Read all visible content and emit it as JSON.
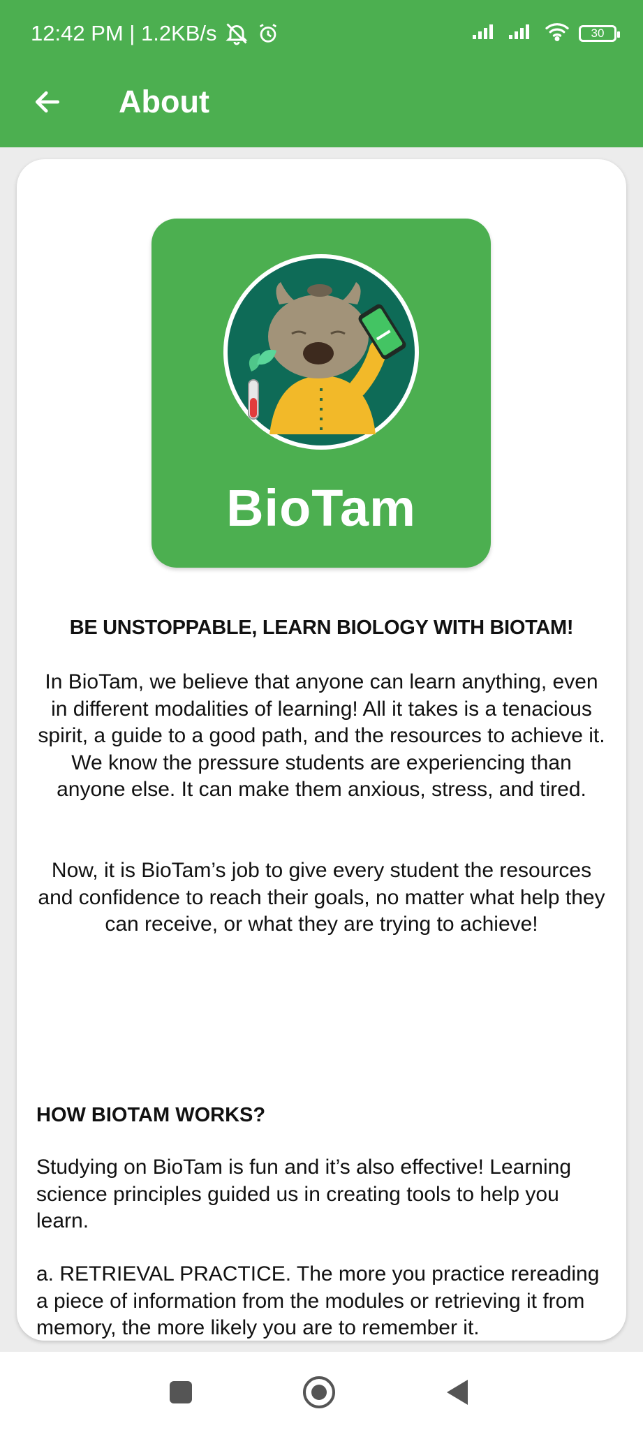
{
  "status_bar": {
    "time_speed": "12:42 PM | 1.2KB/s",
    "icons": [
      "silent-bell-icon",
      "alarm-icon",
      "signal-icon",
      "signal-icon",
      "wifi-icon",
      "battery-icon"
    ],
    "battery_level": "30"
  },
  "toolbar": {
    "back_icon": "arrow-left-icon",
    "title": "About",
    "color": "#4CAF50"
  },
  "logo": {
    "name": "BioTam",
    "tile_color": "#4CAF50"
  },
  "about": {
    "slogan": "BE UNSTOPPABLE, LEARN BIOLOGY WITH BIOTAM!",
    "paragraph1": "In BioTam, we believe that anyone can learn anything, even in different modalities of learning! All it takes is a tenacious spirit, a guide to a good path, and the resources to achieve it. We know the pressure students are experiencing than anyone else. It can make them anxious, stress, and tired.",
    "paragraph2": "Now, it is BioTam’s job to give every student the resources and confidence to reach their goals, no matter what help they can receive, or what they are trying to achieve!",
    "how_heading": "HOW BIOTAM WORKS?",
    "paragraph3": "Studying on BioTam is fun and it’s also effective! Learning science principles guided us in creating tools to help you learn.",
    "paragraph4": "a. RETRIEVAL PRACTICE. The more you practice rereading a piece of information from the modules or retrieving it from memory, the more likely you are to remember it."
  },
  "nav_bar": {
    "icons": [
      "recents-square-icon",
      "home-circle-icon",
      "back-triangle-icon"
    ]
  }
}
